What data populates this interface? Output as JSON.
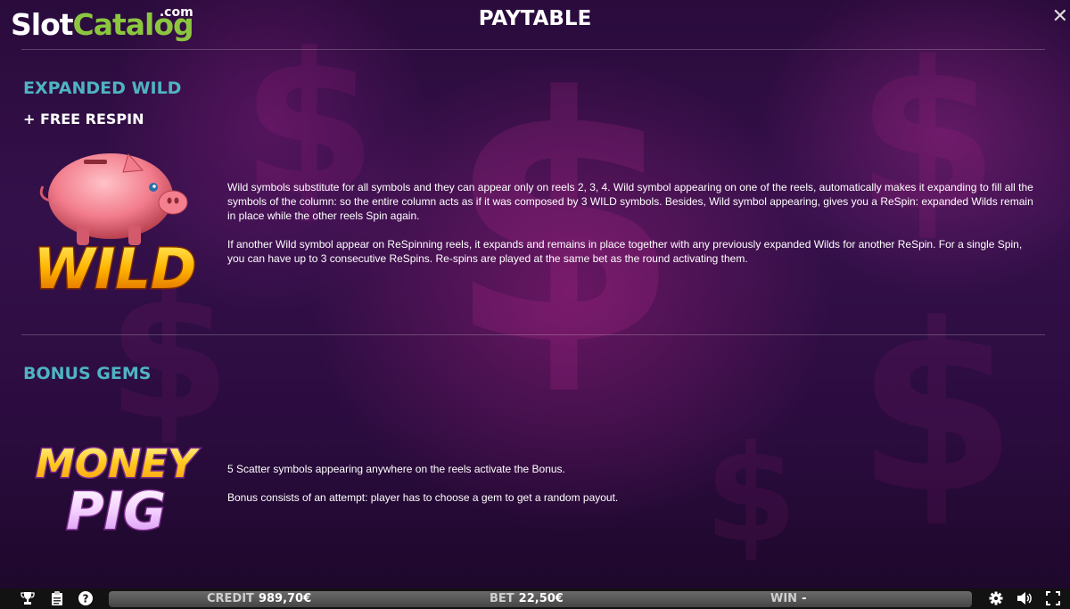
{
  "header": {
    "logo_slot": "Slot",
    "logo_catalog": "Catalog",
    "logo_com": ".com",
    "title": "PAYTABLE",
    "close_icon": "close-icon"
  },
  "sections": [
    {
      "title": "EXPANDED WILD",
      "subtitle": "+ FREE RESPIN",
      "symbol_text": "WILD",
      "paragraphs": [
        "Wild symbols substitute for all symbols and they can appear only on reels 2, 3, 4. Wild symbol appearing on one of the reels, automatically makes it expanding to fill all the symbols of the column: so the entire column acts as if it was composed by 3 WILD symbols. Besides, Wild symbol appearing, gives you a ReSpin: expanded Wilds remain in place while the other reels Spin again.",
        "If another Wild symbol appear on ReSpinning reels, it expands and remains in place together with any previously expanded Wilds for another ReSpin. For a single Spin, you can have up to 3 consecutive ReSpins. Re-spins are played at the same bet as the round activating them."
      ]
    },
    {
      "title": "BONUS GEMS",
      "symbol_text_line1": "MONEY",
      "symbol_text_line2": "PIG",
      "paragraphs": [
        "5 Scatter symbols appearing anywhere on the reels activate the Bonus.",
        "Bonus consists of an attempt: player has to choose a gem to get a random payout."
      ]
    }
  ],
  "bottom_bar": {
    "credit_label": "CREDIT",
    "credit_value": "989,70€",
    "bet_label": "BET",
    "bet_value": "22,50€",
    "win_label": "WIN",
    "win_value": "-",
    "left_icons": [
      "trophy-icon",
      "clipboard-icon",
      "help-icon"
    ],
    "right_icons": [
      "gear-icon",
      "speaker-icon",
      "fullscreen-icon"
    ]
  },
  "colors": {
    "section_title": "#4fb3c2",
    "logo_green": "#8cc63f",
    "background": "#2a0b3c"
  }
}
